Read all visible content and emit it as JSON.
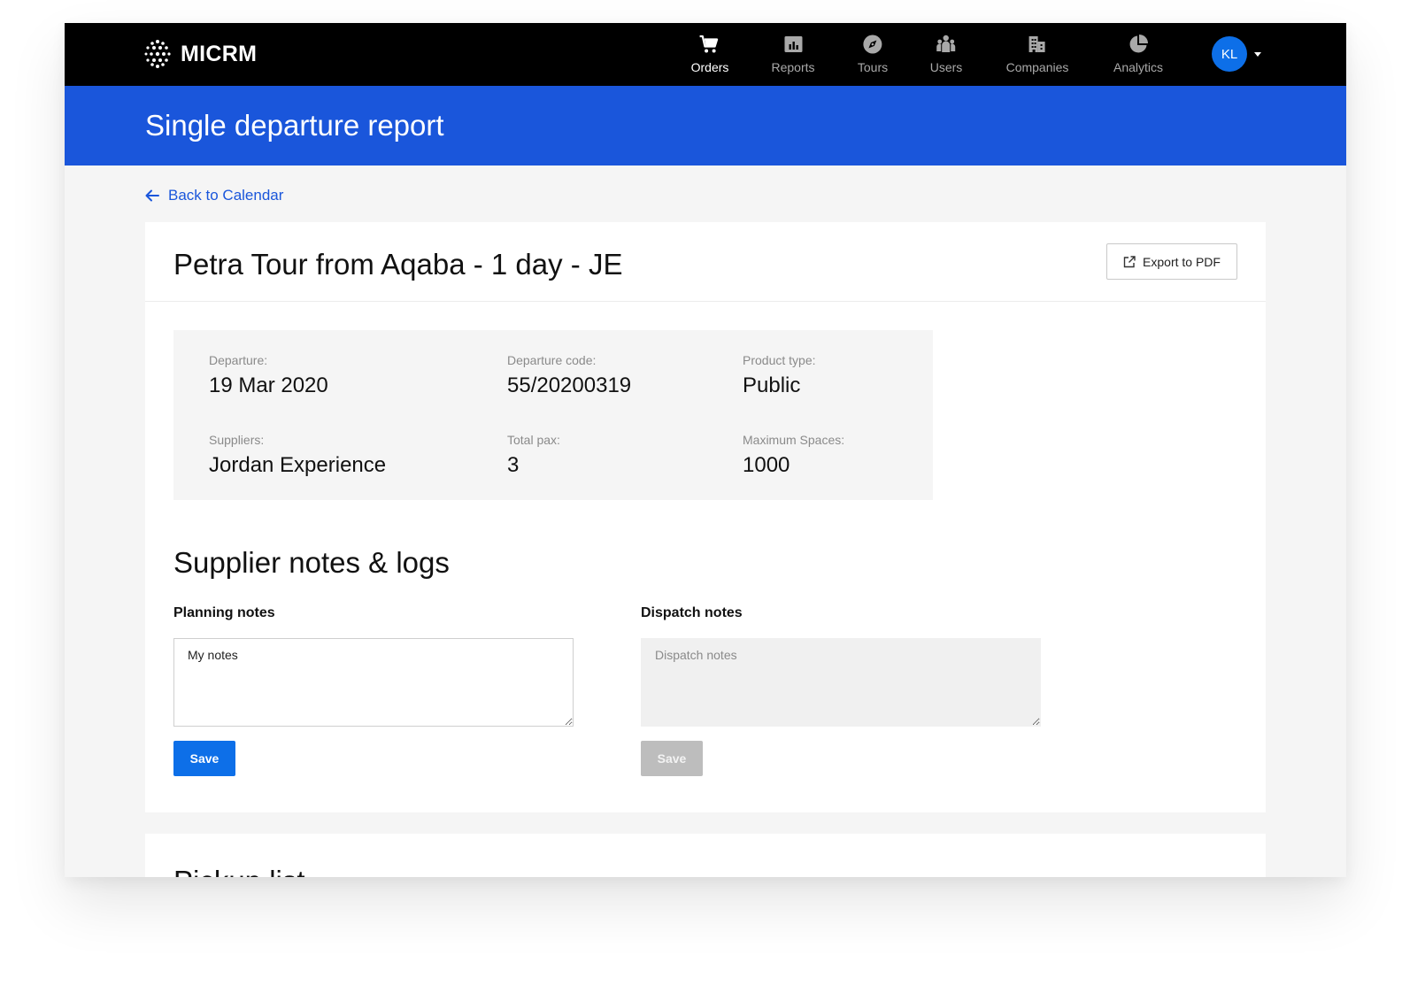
{
  "app": {
    "brand": "MICRM"
  },
  "nav": {
    "items": [
      {
        "label": "Orders",
        "icon": "cart-icon",
        "active": true
      },
      {
        "label": "Reports",
        "icon": "bar-chart-icon",
        "active": false
      },
      {
        "label": "Tours",
        "icon": "compass-icon",
        "active": false
      },
      {
        "label": "Users",
        "icon": "users-icon",
        "active": false
      },
      {
        "label": "Companies",
        "icon": "building-icon",
        "active": false
      },
      {
        "label": "Analytics",
        "icon": "pie-chart-icon",
        "active": false
      }
    ],
    "avatar_initials": "KL"
  },
  "page": {
    "title": "Single departure report",
    "back_link": "Back to Calendar"
  },
  "tour": {
    "title": "Petra Tour from Aqaba - 1 day - JE",
    "export_label": "Export to PDF",
    "fields": {
      "departure": {
        "label": "Departure:",
        "value": "19 Mar 2020"
      },
      "departure_code": {
        "label": "Departure code:",
        "value": "55/20200319"
      },
      "product_type": {
        "label": "Product type:",
        "value": "Public"
      },
      "suppliers": {
        "label": "Suppliers:",
        "value": "Jordan Experience"
      },
      "total_pax": {
        "label": "Total pax:",
        "value": "3"
      },
      "max_spaces": {
        "label": "Maximum Spaces:",
        "value": "1000"
      }
    }
  },
  "notes": {
    "section_title": "Supplier notes & logs",
    "planning": {
      "label": "Planning notes",
      "value": "My notes ",
      "save_label": "Save"
    },
    "dispatch": {
      "label": "Dispatch notes",
      "value": "",
      "placeholder": "Dispatch notes",
      "save_label": "Save"
    }
  },
  "next_section": {
    "title": "Pickup list"
  },
  "colors": {
    "topbar": "#000000",
    "header": "#1a56db",
    "primary_button": "#0d6fe8",
    "disabled_button": "#bdbdbd",
    "background": "#f5f5f5"
  }
}
